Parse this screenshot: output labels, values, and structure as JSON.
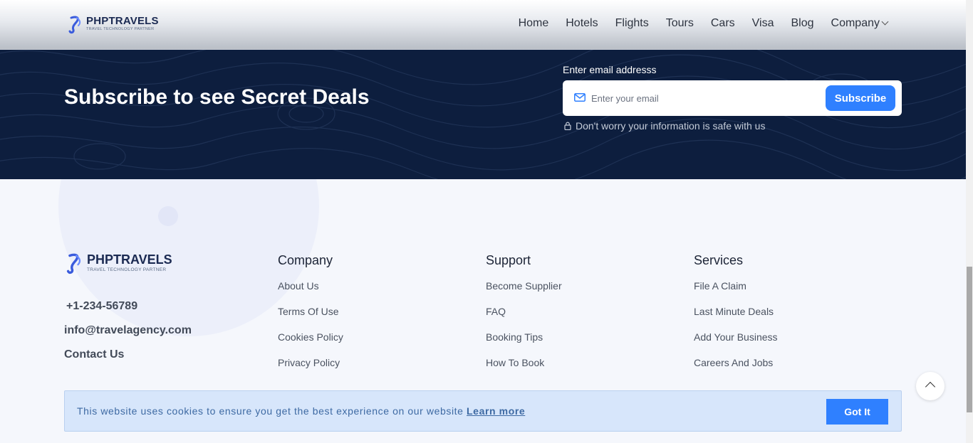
{
  "header": {
    "logo_name": "PHPTRAVELS",
    "logo_tag": "TRAVEL TECHNOLOGY PARTNER",
    "nav": [
      "Home",
      "Hotels",
      "Flights",
      "Tours",
      "Cars",
      "Visa",
      "Blog",
      "Company"
    ]
  },
  "subscribe": {
    "title": "Subscribe to see Secret Deals",
    "email_label": "Enter email addresss",
    "email_placeholder": "Enter your email",
    "button": "Subscribe",
    "note": "Don't worry your information is safe with us"
  },
  "footer": {
    "logo_name": "PHPTRAVELS",
    "logo_tag": "TRAVEL TECHNOLOGY PARTNER",
    "phone": "+1-234-56789",
    "email": "info@travelagency.com",
    "contact": "Contact Us",
    "columns": [
      {
        "title": "Company",
        "links": [
          "About Us",
          "Terms Of Use",
          "Cookies Policy",
          "Privacy Policy"
        ]
      },
      {
        "title": "Support",
        "links": [
          "Become Supplier",
          "FAQ",
          "Booking Tips",
          "How To Book"
        ]
      },
      {
        "title": "Services",
        "links": [
          "File A Claim",
          "Last Minute Deals",
          "Add Your Business",
          "Careers And Jobs"
        ]
      }
    ]
  },
  "cookie": {
    "message": "This website uses cookies to ensure you get the best experience on our website",
    "learn_more": "Learn more",
    "button": "Got It"
  },
  "colors": {
    "brand_blue": "#2f80ff",
    "band_navy": "#0d1e3e",
    "footer_bg": "#f5f7fc"
  },
  "icons": [
    "logo-mark-icon",
    "mail-icon",
    "lock-icon",
    "chevron-down-icon",
    "chevron-up-icon"
  ]
}
